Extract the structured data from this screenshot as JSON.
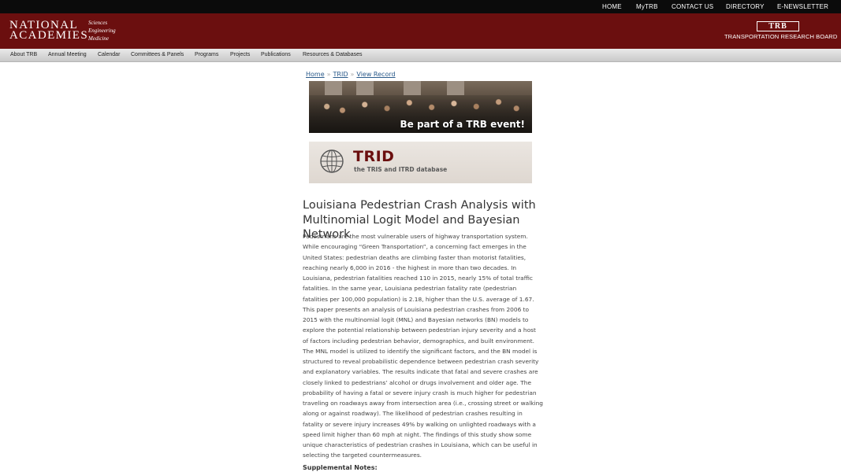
{
  "topbar": {
    "links": [
      "HOME",
      "MyTRB",
      "CONTACT US",
      "DIRECTORY",
      "E-NEWSLETTER"
    ]
  },
  "header": {
    "na_logo_text": "NATIONAL ACADEMIES",
    "na_subtitles": [
      "Sciences",
      "Engineering",
      "Medicine"
    ],
    "trb_logo_text": "TRB",
    "trb_name": "TRANSPORTATION RESEARCH BOARD"
  },
  "nav": {
    "items": [
      "About TRB",
      "Annual Meeting",
      "Calendar",
      "Committees & Panels",
      "Programs",
      "Projects",
      "Publications",
      "Resources & Databases"
    ]
  },
  "breadcrumb": {
    "items": [
      "Home",
      "TRID",
      "View Record"
    ],
    "separator": "»"
  },
  "banner": {
    "text": "Be part of a TRB event!"
  },
  "trid": {
    "title": "TRID",
    "subtitle": "the TRIS and ITRD database"
  },
  "record": {
    "title": "Louisiana Pedestrian Crash Analysis with Multinomial Logit Model and Bayesian Network",
    "abstract": "Pedestrians are the most vulnerable users of highway transportation system. While encouraging “Green Transportation”, a concerning fact emerges in the United States: pedestrian deaths are climbing faster than motorist fatalities, reaching nearly 6,000 in 2016 - the highest in more than two decades. In Louisiana, pedestrian fatalities reached 110 in 2015, nearly 15% of total traffic fatalities. In the same year, Louisiana pedestrian fatality rate (pedestrian fatalities per 100,000 population) is 2.18, higher than the U.S. average of 1.67. This paper presents an analysis of Louisiana pedestrian crashes from 2006 to 2015 with the multinomial logit (MNL) and Bayesian networks (BN) models to explore the potential relationship between pedestrian injury severity and a host of factors including pedestrian behavior, demographics, and built environment. The MNL model is utilized to identify the significant factors, and the BN model is structured to reveal probabilistic dependence between pedestrian crash severity and explanatory variables. The results indicate that fatal and severe crashes are closely linked to pedestrians’ alcohol or drugs involvement and older age. The probability of having a fatal or severe injury crash is much higher for pedestrian traveling on roadways away from intersection area (i.e., crossing street or walking along or against roadway). The likelihood of pedestrian crashes resulting in fatality or severe injury increases 49% by walking on unlighted roadways with a speed limit higher than 60 mph at night. The findings of this study show some unique characteristics of pedestrian crashes in Louisiana, which can be useful in selecting the targeted countermeasures.",
    "supplemental_label": "Supplemental Notes:"
  },
  "colors": {
    "topbar": "#0b0b0b",
    "header": "#6b0f0f",
    "link": "#2a5a8a",
    "trid_title": "#6b0f0f"
  }
}
